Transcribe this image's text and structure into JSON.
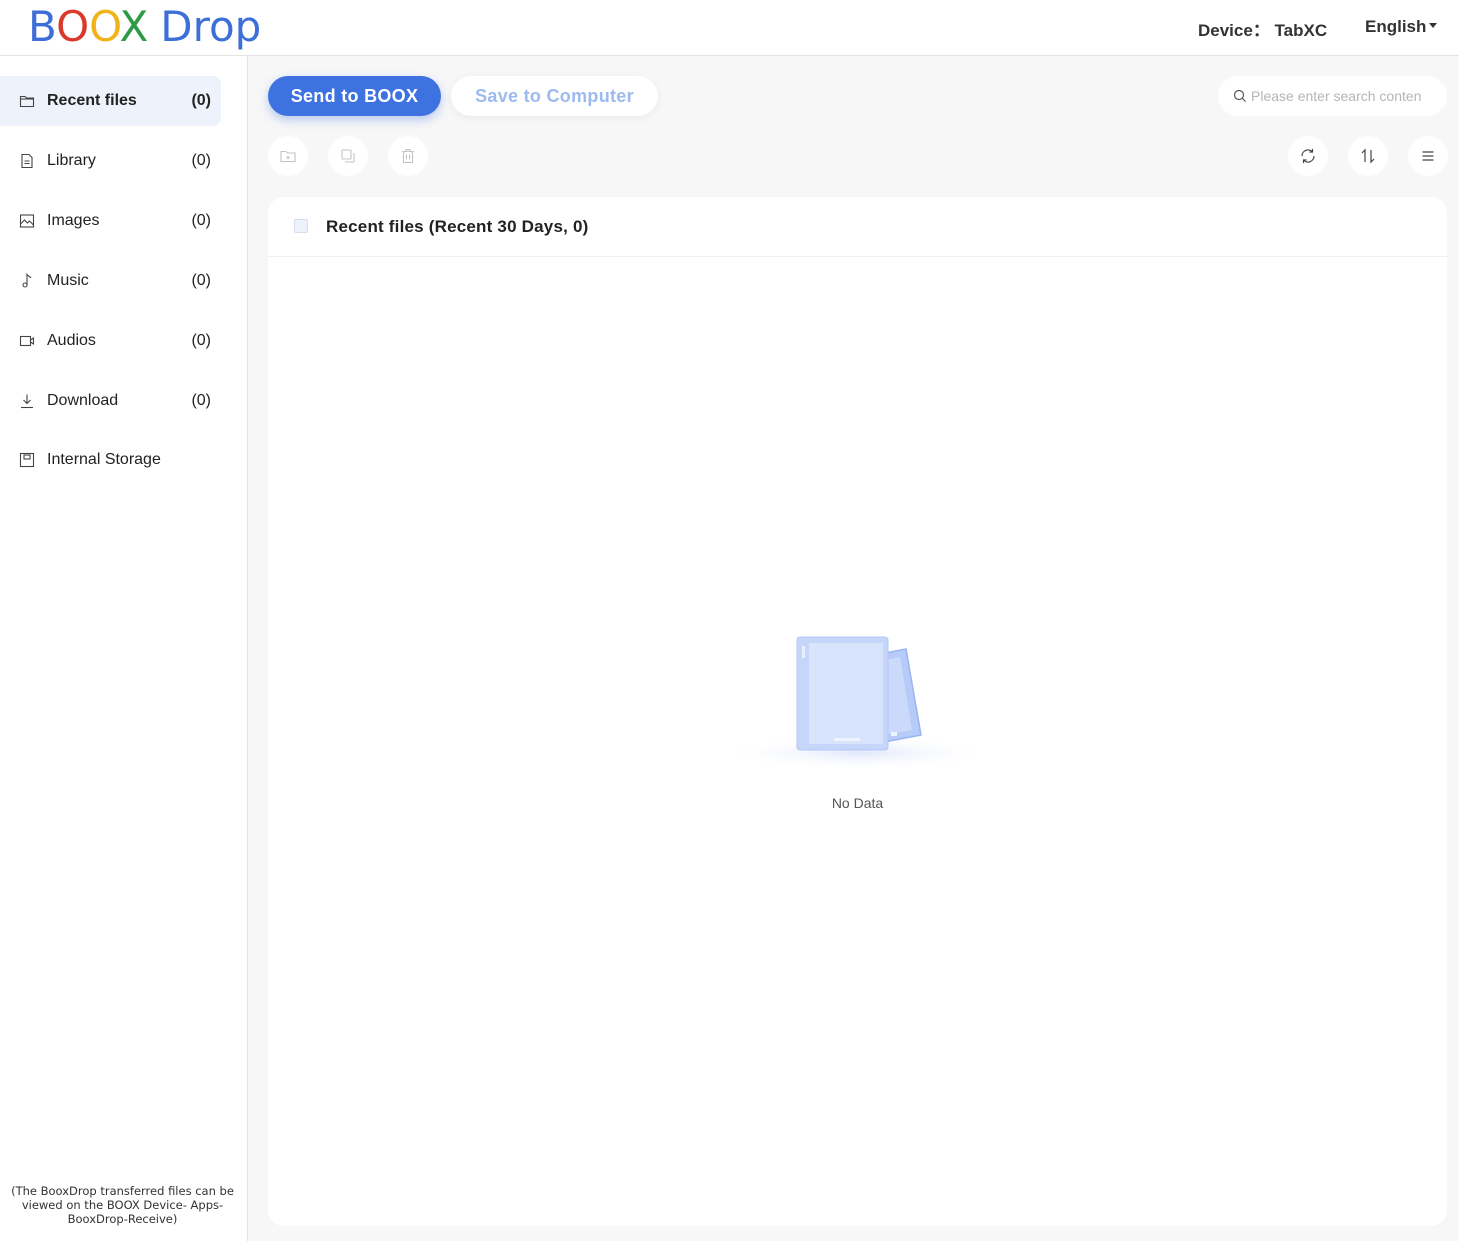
{
  "header": {
    "logo": {
      "b": "B",
      "o1": "O",
      "o2": "O",
      "x": "X",
      "drop": "Drop"
    },
    "device": "Device： TabXC",
    "language": "English"
  },
  "sidebar": {
    "items": [
      {
        "label": "Recent files",
        "count": "(0)",
        "icon": "folder-icon",
        "active": true
      },
      {
        "label": "Library",
        "count": "(0)",
        "icon": "document-icon"
      },
      {
        "label": "Images",
        "count": "(0)",
        "icon": "image-icon"
      },
      {
        "label": "Music",
        "count": "(0)",
        "icon": "music-note-icon"
      },
      {
        "label": "Audios",
        "count": "(0)",
        "icon": "video-camera-icon"
      },
      {
        "label": "Download",
        "count": "(0)",
        "icon": "download-icon"
      },
      {
        "label": "Internal Storage",
        "count": "",
        "icon": "storage-icon"
      }
    ],
    "note": "(The BooxDrop transferred files can be viewed on the BOOX Device- Apps-BooxDrop-Receive)"
  },
  "toolbar": {
    "send_label": "Send to BOOX",
    "save_label": "Save to Computer",
    "search_placeholder": "Please enter search content"
  },
  "panel": {
    "title": "Recent files (Recent 30 Days, 0)",
    "empty_text": "No Data"
  },
  "colors": {
    "accent": "#3e72e0",
    "accent_light": "#9dbaf0",
    "active_bg": "#eef3fb",
    "main_bg": "#f7f7f7"
  }
}
